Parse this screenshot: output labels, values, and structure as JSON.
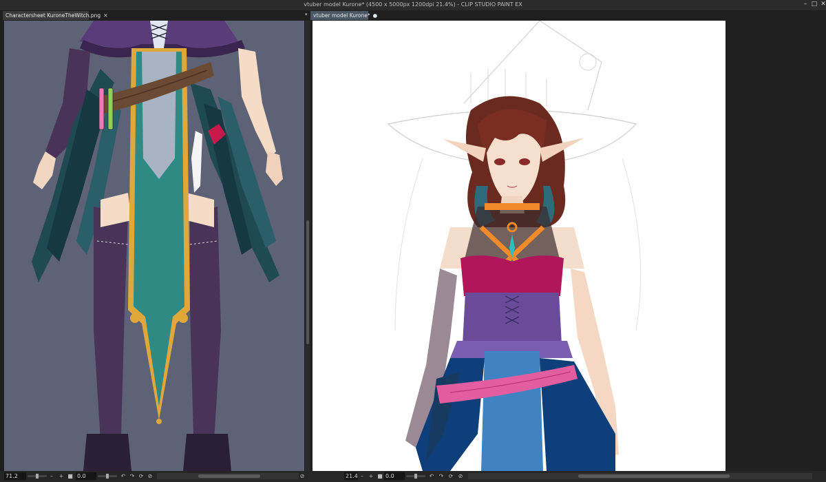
{
  "window": {
    "title": "vtuber model Kurone* (4500 x 5000px 1200dpi 21.4%)  - CLIP STUDIO PAINT EX",
    "controls": {
      "minimize": "–",
      "maximize": "□",
      "close": "✕"
    }
  },
  "tabs": [
    {
      "label": "Charactersheet KuroneTheWitch.png",
      "close": "✕"
    },
    {
      "label": "vtuber model Kurone*",
      "indicator": "●"
    }
  ],
  "left_view": {
    "zoom": "71.2",
    "rotation": "0.0"
  },
  "right_view": {
    "zoom": "21.4",
    "rotation": "0.0"
  },
  "icons": {
    "zoom_out": "–",
    "zoom_in": "+",
    "fit": "■",
    "rotate_left": "↶",
    "rotate_right": "↷",
    "reset": "⟳",
    "flip": "⊘"
  },
  "colors": {
    "app_bg": "#1f1f1f",
    "tab_active": "#4a5866",
    "left_canvas_bg": "#5e6276",
    "dress_teal": "#2f8a86",
    "belt_brown": "#6b4a33",
    "trim_gold": "#e0a83a",
    "feather_dark": "#1f4a52",
    "skin": "#f5dcc6",
    "bodice_pink": "#b0165a",
    "corset_purple": "#6a4c9b",
    "skirt_blue": "#3f83c2",
    "belt_pink": "#e35ea0",
    "strap_orange": "#f08a2a",
    "hair_brown": "#6b2a1f"
  }
}
